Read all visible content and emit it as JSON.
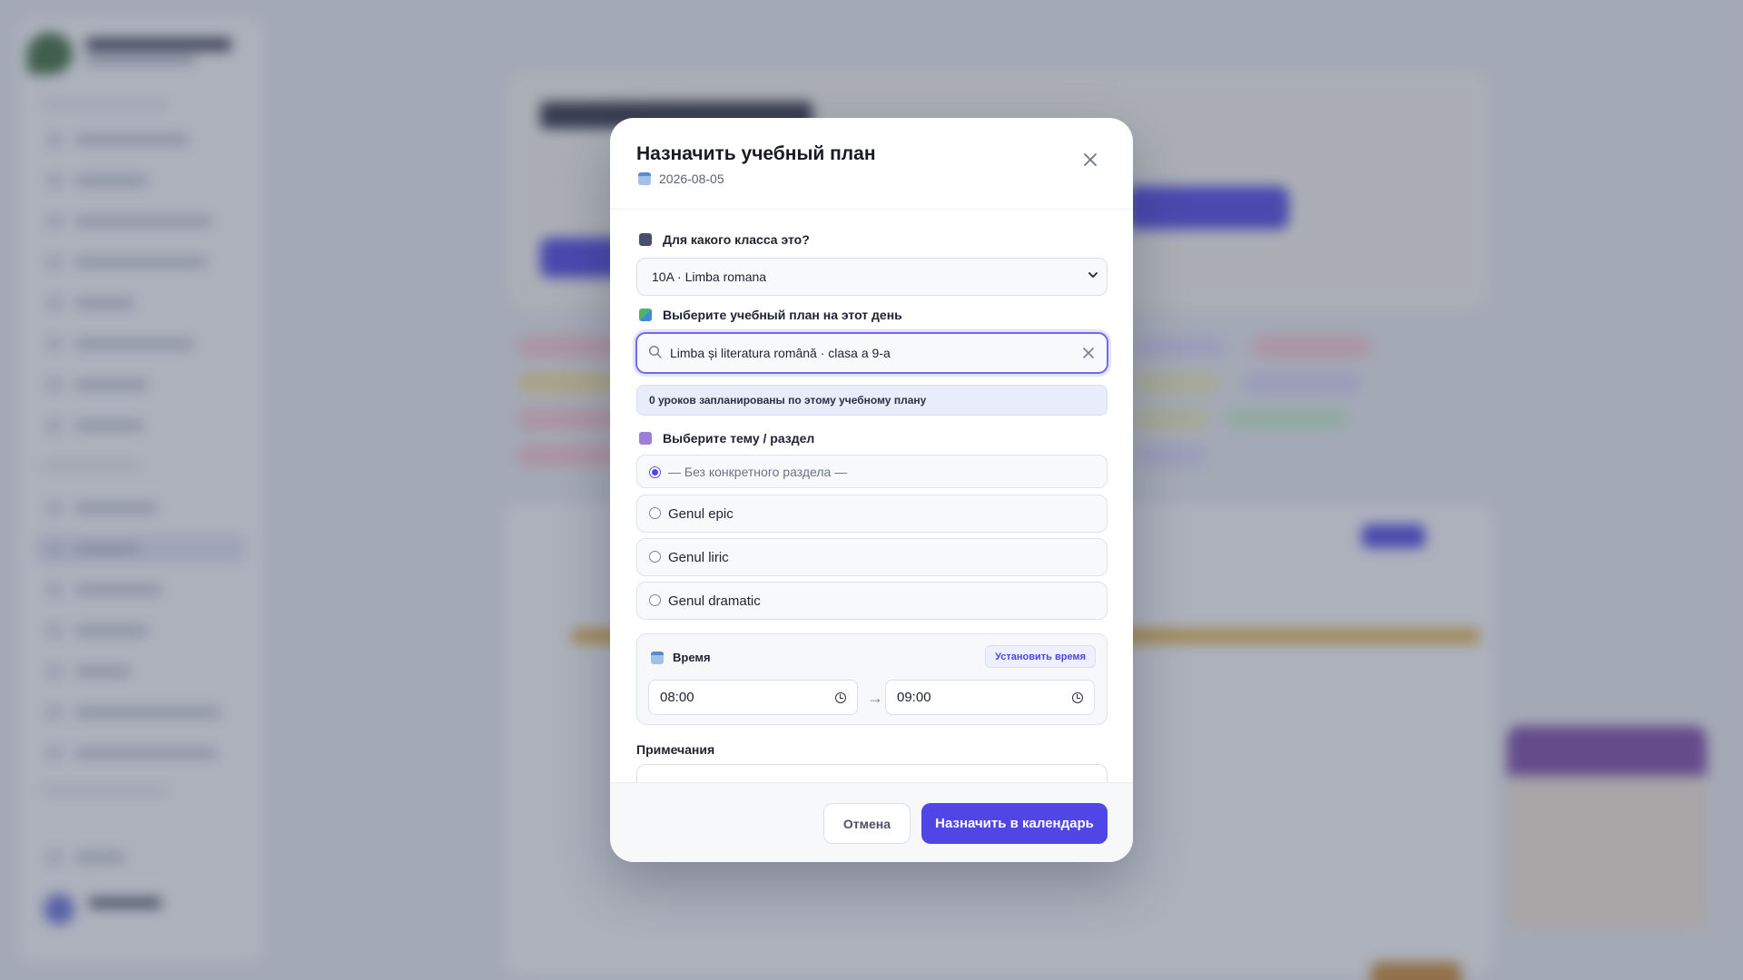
{
  "modal": {
    "title": "Назначить учебный план",
    "date": "2026-08-05",
    "class_label": "Для какого класса это?",
    "class_value": "10A · Limba romana",
    "plan_label": "Выберите учебный план на этот день",
    "plan_search_value": "Limba și literatura română · clasa a 9-a",
    "plan_info": "0 уроков запланированы по этому учебному плану",
    "topic_label": "Выберите тему / раздел",
    "topics": [
      {
        "label": "— Без конкретного раздела —",
        "selected": true
      },
      {
        "label": "Genul epic",
        "selected": false
      },
      {
        "label": "Genul liric",
        "selected": false
      },
      {
        "label": "Genul dramatic",
        "selected": false
      }
    ],
    "time_label": "Время",
    "set_time_button": "Установить время",
    "time_start": "08:00",
    "time_end": "09:00",
    "time_arrow": "→",
    "notes_label": "Примечания",
    "cancel_button": "Отмена",
    "assign_button": "Назначить в календарь"
  },
  "colors": {
    "accent": "#4f46e5",
    "overlay": "#464e64"
  },
  "icons": {
    "close": "close-icon",
    "calendar": "calendar-icon",
    "search": "search-icon",
    "clear": "clear-icon",
    "clock": "clock-icon",
    "chevron": "chevron-down-icon"
  }
}
